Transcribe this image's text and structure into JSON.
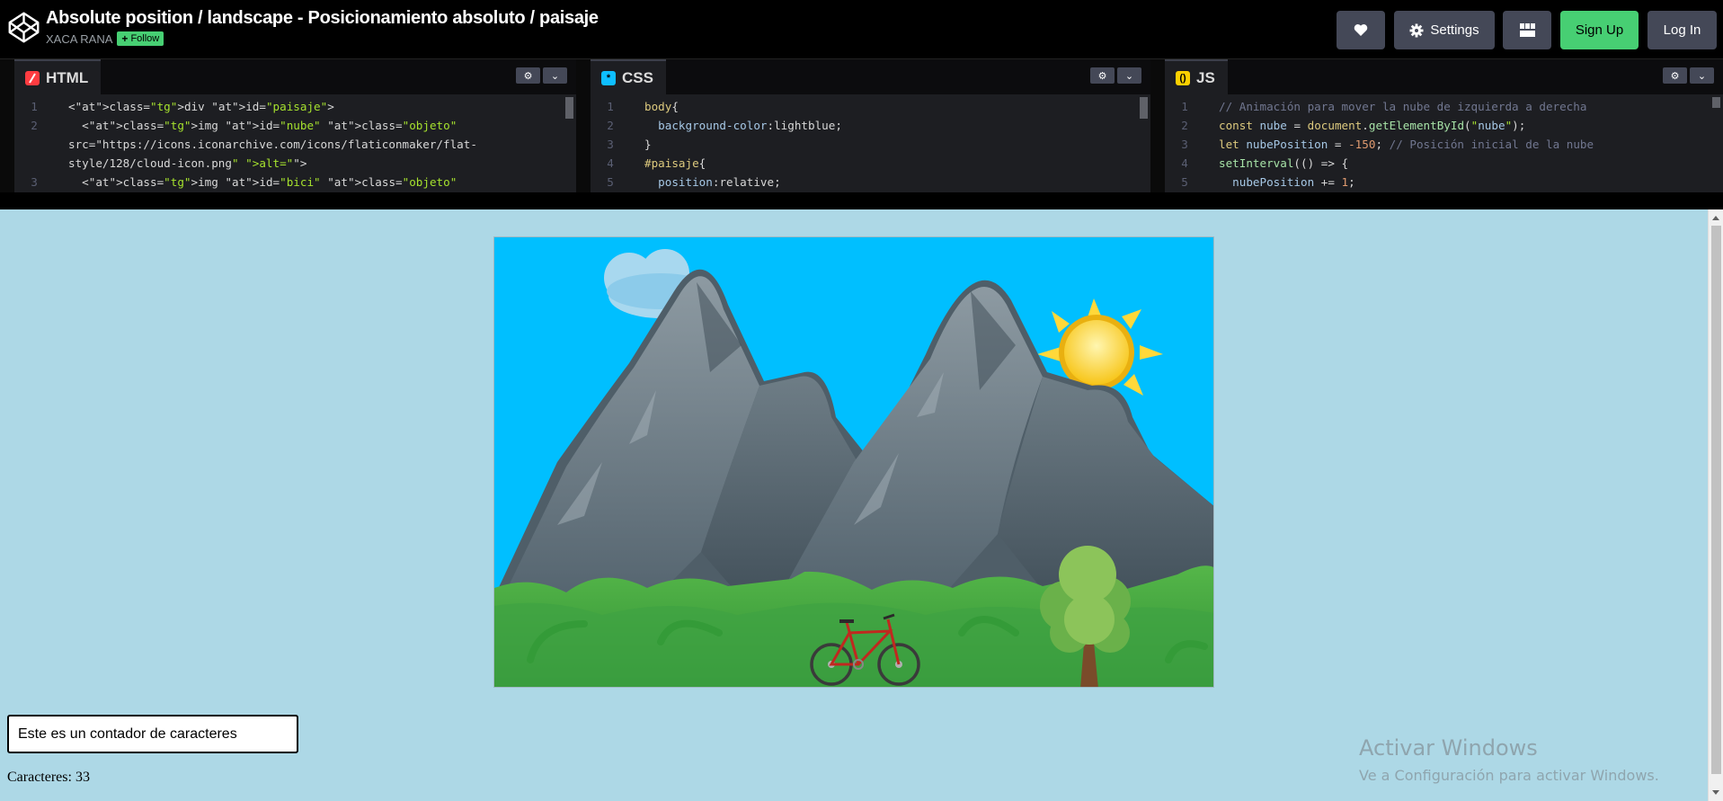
{
  "header": {
    "title": "Absolute position / landscape - Posicionamiento absoluto / paisaje",
    "author": "XACA RANA",
    "follow_label": "Follow",
    "settings_label": "Settings",
    "signup_label": "Sign Up",
    "login_label": "Log In"
  },
  "editors": {
    "html": {
      "tab_label": "HTML",
      "icon_color": "#ff3c41"
    },
    "css": {
      "tab_label": "CSS",
      "icon_color": "#0ebeff"
    },
    "js": {
      "tab_label": "JS",
      "icon_color": "#fcd000"
    }
  },
  "code": {
    "html": [
      {
        "n": "1",
        "text": "<div id=\"paisaje\">"
      },
      {
        "n": "2",
        "text": "  <img id=\"nube\" class=\"objeto\""
      },
      {
        "n": "",
        "text": "src=\"https://icons.iconarchive.com/icons/flaticonmaker/flat-"
      },
      {
        "n": "",
        "text": "style/128/cloud-icon.png\" alt=\"\">"
      },
      {
        "n": "3",
        "text": "  <img id=\"bici\" class=\"objeto\""
      }
    ],
    "css": [
      {
        "n": "1",
        "text": "body{"
      },
      {
        "n": "2",
        "text": "  background-color:lightblue;"
      },
      {
        "n": "3",
        "text": "}"
      },
      {
        "n": "4",
        "text": "#paisaje{"
      },
      {
        "n": "5",
        "text": "  position:relative;"
      }
    ],
    "js": [
      {
        "n": "1",
        "text": "// Animación para mover la nube de izquierda a derecha"
      },
      {
        "n": "2",
        "text": "const nube = document.getElementById(\"nube\");"
      },
      {
        "n": "3",
        "text": "let nubePosition = -150; // Posición inicial de la nube"
      },
      {
        "n": "4",
        "text": "setInterval(() => {"
      },
      {
        "n": "5",
        "text": "  nubePosition += 1;"
      }
    ]
  },
  "preview": {
    "input_value": "Este es un contador de caracteres",
    "count_text": "Caracteres: 33",
    "watermark_title": "Activar Windows",
    "watermark_sub": "Ve a Configuración para activar Windows.",
    "background_color": "#add8e6"
  }
}
